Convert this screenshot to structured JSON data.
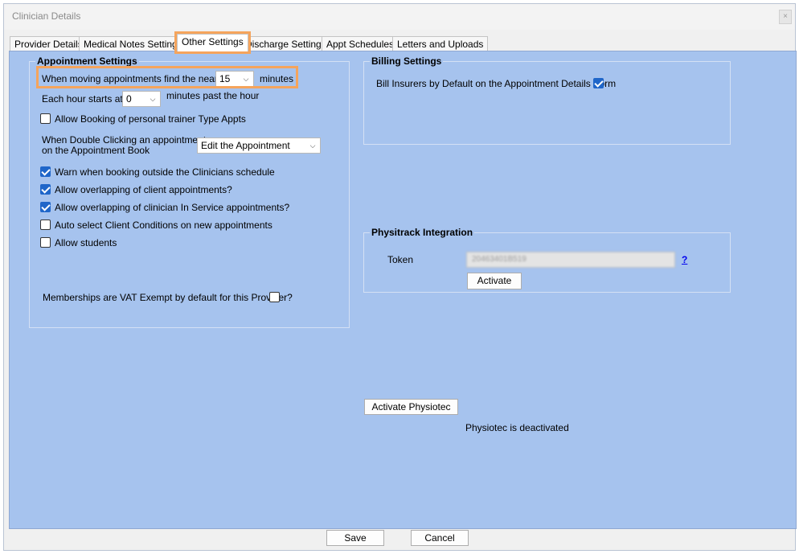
{
  "window": {
    "title": "Clinician Details",
    "close_label": "×"
  },
  "tabs": [
    {
      "label": "Provider Details"
    },
    {
      "label": "Medical Notes Settings"
    },
    {
      "label": "Other Settings"
    },
    {
      "label": "Discharge Settings"
    },
    {
      "label": "Appt Schedules"
    },
    {
      "label": "Letters and Uploads"
    }
  ],
  "active_tab": "Other Settings",
  "appointment_settings": {
    "title": "Appointment Settings",
    "nearest_label": "When moving appointments find the nearest",
    "nearest_value": "15",
    "nearest_suffix": "minutes",
    "hour_starts_label": "Each hour starts at",
    "hour_starts_value": "0",
    "hour_starts_suffix": "minutes past the hour",
    "personal_trainer_label": "Allow Booking of personal trainer Type Appts",
    "personal_trainer_checked": false,
    "double_click_label_line1": "When Double Clicking an appointment",
    "double_click_label_line2": "on the Appointment Book",
    "double_click_value": "Edit the Appointment",
    "warn_outside_label": "Warn when booking outside the Clinicians schedule",
    "warn_outside_checked": true,
    "overlap_client_label": "Allow overlapping of client appointments?",
    "overlap_client_checked": true,
    "overlap_inservice_label": "Allow overlapping of clinician In Service appointments?",
    "overlap_inservice_checked": true,
    "auto_select_label": "Auto select Client Conditions on new appointments",
    "auto_select_checked": false,
    "allow_students_label": "Allow students",
    "allow_students_checked": false,
    "vat_exempt_label": "Memberships are VAT Exempt by default for this Provider?",
    "vat_exempt_checked": false
  },
  "billing_settings": {
    "title": "Billing Settings",
    "bill_insurers_label": "Bill Insurers by Default on the Appointment Details Form",
    "bill_insurers_checked": true
  },
  "physitrack": {
    "title": "Physitrack Integration",
    "token_label": "Token",
    "token_value": "20463401B519",
    "help_label": "?",
    "activate_label": "Activate"
  },
  "physiotec": {
    "activate_label": "Activate Physiotec",
    "status": "Physiotec is deactivated"
  },
  "footer": {
    "save_label": "Save",
    "cancel_label": "Cancel"
  },
  "colors": {
    "panel_bg": "#a6c3ee",
    "highlight": "#f5a45c",
    "checkbox_on": "#1f66c9"
  }
}
